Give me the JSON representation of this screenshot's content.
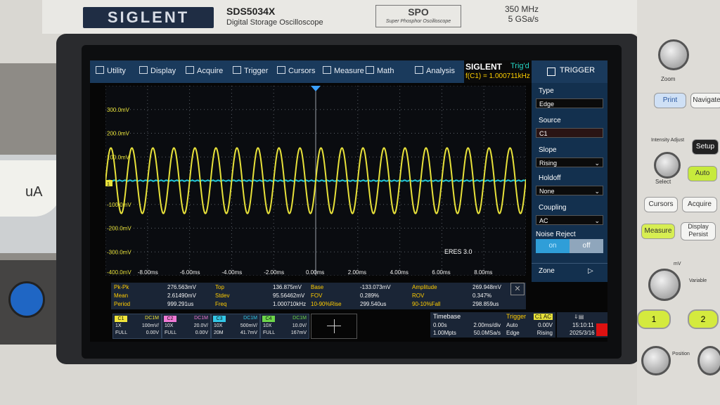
{
  "bezel": {
    "brand": "SIGLENT",
    "model": "SDS5034X",
    "model_subtitle": "Digital Storage Oscilloscope",
    "spo_logo": "SPO",
    "spo_subtitle": "Super Phosphor Oscilloscope",
    "bandwidth": "350 MHz",
    "sample_rate": "5 GSa/s"
  },
  "menu": {
    "items": [
      "Utility",
      "Display",
      "Acquire",
      "Trigger",
      "Cursors",
      "Measure",
      "Math",
      "Analysis"
    ],
    "logo": "SIGLENT",
    "trig_status": "Trig'd",
    "freq_readout": "f(C1) = 1.000711kHz"
  },
  "trigger_panel": {
    "title": "TRIGGER",
    "type_label": "Type",
    "type_value": "Edge",
    "source_label": "Source",
    "source_value": "C1",
    "slope_label": "Slope",
    "slope_value": "Rising",
    "holdoff_label": "Holdoff",
    "holdoff_value": "None",
    "coupling_label": "Coupling",
    "coupling_value": "AC",
    "noise_label": "Noise Reject",
    "noise_on": "on",
    "noise_off": "off",
    "zone_label": "Zone"
  },
  "plot": {
    "y_labels": [
      "300.0mV",
      "200.0mV",
      "100.0mV",
      "-100.0mV",
      "-200.0mV",
      "-300.0mV",
      "-400.0mV"
    ],
    "x_labels": [
      "-8.00ms",
      "-6.00ms",
      "-4.00ms",
      "-2.00ms",
      "0.00ms",
      "2.00ms",
      "4.00ms",
      "6.00ms",
      "8.00ms"
    ],
    "eres": "ERES 3.0",
    "signal_frequency_khz": 1.000711,
    "signal_amplitude_mv": 138,
    "trace_color": "#e8e23a",
    "math_color": "#22c7d8",
    "channel_marker": "1"
  },
  "measurements": [
    [
      [
        "Pk-Pk",
        "276.563mV"
      ],
      [
        "Top",
        "136.875mV"
      ],
      [
        "Base",
        "-133.073mV"
      ],
      [
        "Amplitude",
        "269.948mV"
      ]
    ],
    [
      [
        "Mean",
        "2.61490mV"
      ],
      [
        "Stdev",
        "95.56462mV"
      ],
      [
        "FOV",
        "0.289%"
      ],
      [
        "ROV",
        "0.347%"
      ]
    ],
    [
      [
        "Period",
        "999.291us"
      ],
      [
        "Freq",
        "1.000710kHz"
      ],
      [
        "10-90%Rise",
        "299.540us"
      ],
      [
        "90-10%Fall",
        "298.859us"
      ]
    ]
  ],
  "channels": [
    {
      "tag": "C1",
      "coupling": "DC1M",
      "probe": "1X",
      "scale": "100mV/",
      "bw": "FULL",
      "offset": "0.00V",
      "color": "#f0e43a"
    },
    {
      "tag": "C2",
      "coupling": "DC1M",
      "probe": "10X",
      "scale": "20.0V/",
      "bw": "FULL",
      "offset": "0.00V",
      "color": "#f07ad6"
    },
    {
      "tag": "C3",
      "coupling": "DC1M",
      "probe": "10X",
      "scale": "500mV/",
      "bw": "20M",
      "offset": "41.7mV",
      "color": "#33c8e8"
    },
    {
      "tag": "C4",
      "coupling": "DC1M",
      "probe": "10X",
      "scale": "10.0V/",
      "bw": "FULL",
      "offset": "167mV",
      "color": "#6dd64a"
    }
  ],
  "timebase": {
    "title": "Timebase",
    "delay": "0.00s",
    "scale": "2.00ms/div",
    "mpts": "1.00Mpts",
    "rate": "50.0MSa/s"
  },
  "trigger_status": {
    "title": "Trigger",
    "src": "C1 AC",
    "mode": "Auto",
    "level": "0.00V",
    "type": "Edge",
    "slope": "Rising"
  },
  "clock": {
    "time": "15:10:11",
    "date": "2025/3/16"
  },
  "front_panel": {
    "print": "Print",
    "navigate": "Navigate",
    "intensity": "Intensity\nAdjust",
    "setup": "Setup",
    "auto": "Auto",
    "cursors": "Cursors",
    "acquire": "Acquire",
    "measure": "Measure",
    "display": "Display\nPersist",
    "ch1": "1",
    "ch2": "2",
    "position": "Position",
    "select": "Select",
    "zoom": "Zoom",
    "variable": "Variable",
    "mv": "mV"
  },
  "bench": {
    "meter_unit": "uA"
  }
}
